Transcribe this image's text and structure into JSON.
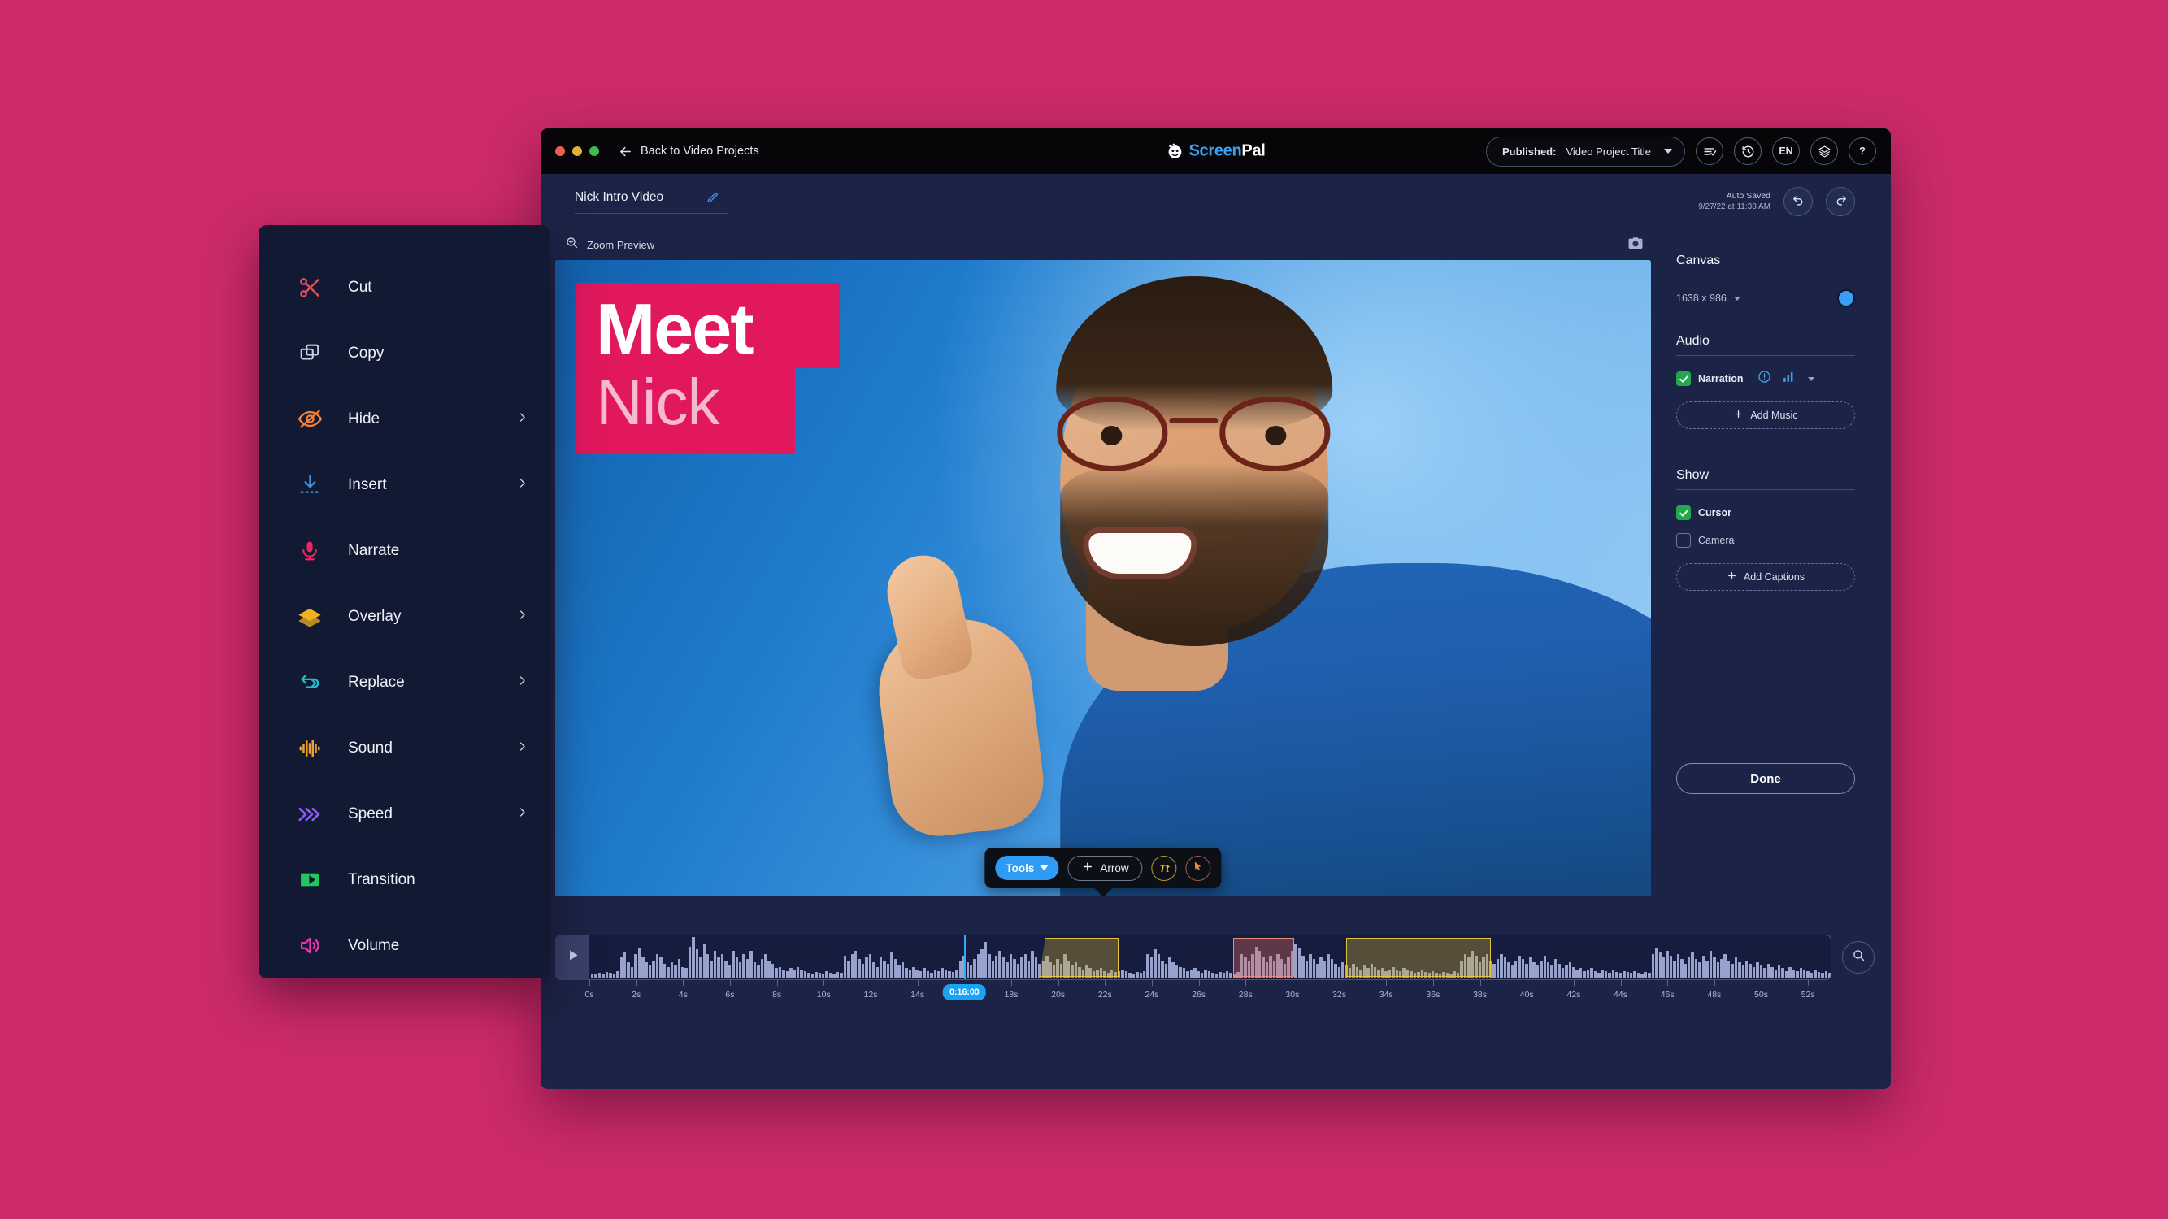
{
  "background_color": "#cc2a6b",
  "titlebar": {
    "back_label": "Back to Video Projects",
    "brand_first": "Screen",
    "brand_second": "Pal",
    "published_prefix": "Published:",
    "published_title": "Video Project Title",
    "icons": [
      {
        "name": "checklist-icon",
        "label": ""
      },
      {
        "name": "history-clock-icon",
        "label": ""
      },
      {
        "name": "language-icon",
        "label": "EN"
      },
      {
        "name": "layers-icon",
        "label": ""
      },
      {
        "name": "help-icon",
        "label": "?"
      }
    ]
  },
  "project": {
    "title": "Nick Intro Video",
    "edit_icon": "edit-pencil-icon",
    "autosave_line1": "Auto Saved",
    "autosave_line2": "9/27/22 at 11:38 AM",
    "undo_icon": "undo-icon",
    "redo_icon": "redo-icon"
  },
  "preview": {
    "zoom_label": "Zoom Preview",
    "zoom_icon": "magnifier-plus-icon",
    "camera_icon": "camera-icon",
    "overlay_line1": "Meet",
    "overlay_line2": "Nick",
    "overlay_bg_color": "#e1185e"
  },
  "toolbar": {
    "tools_label": "Tools",
    "arrow_label": "Arrow",
    "text_tool_label": "Tt",
    "cursor_tool_icon": "cursor-arrow-icon"
  },
  "side_panel": {
    "canvas_heading": "Canvas",
    "canvas_size": "1638 x 986",
    "audio_heading": "Audio",
    "narration_label": "Narration",
    "narration_alert_icon": "alert-circle-icon",
    "narration_levels_icon": "audio-levels-icon",
    "add_music_label": "Add Music",
    "show_heading": "Show",
    "cursor_label": "Cursor",
    "camera_label": "Camera",
    "add_captions_label": "Add Captions",
    "done_label": "Done",
    "accent_blue": "#3c9ef3",
    "accent_green": "#23a94c"
  },
  "timeline": {
    "play_icon": "play-icon",
    "search_icon": "search-icon",
    "playhead_time": "0:16:00",
    "playhead_position_seconds": 16,
    "tick_labels": [
      "0s",
      "2s",
      "4s",
      "6s",
      "8s",
      "10s",
      "12s",
      "14s",
      "18s",
      "20s",
      "22s",
      "24s",
      "26s",
      "28s",
      "30s",
      "32s",
      "34s",
      "36s",
      "38s",
      "40s",
      "42s",
      "44s",
      "46s",
      "48s",
      "50s",
      "52s"
    ],
    "tick_seconds": [
      0,
      2,
      4,
      6,
      8,
      10,
      12,
      14,
      18,
      20,
      22,
      24,
      26,
      28,
      30,
      32,
      34,
      36,
      38,
      40,
      42,
      44,
      46,
      48,
      50,
      52
    ],
    "range_seconds": [
      0,
      53
    ],
    "clips": [
      {
        "name": "yellow-fade-clip",
        "start_seconds": 19.2,
        "end_seconds": 22.6,
        "color": "#e2c23d",
        "shape": "trapezoid"
      },
      {
        "name": "red-clip",
        "start_seconds": 27.5,
        "end_seconds": 30.1,
        "color": "#e98a7a",
        "shape": "rect"
      },
      {
        "name": "yellow-clip",
        "start_seconds": 32.3,
        "end_seconds": 38.5,
        "color": "#e2c23d",
        "shape": "rect"
      }
    ],
    "waveform": [
      4,
      5,
      6,
      5,
      7,
      6,
      5,
      8,
      26,
      32,
      20,
      14,
      30,
      38,
      26,
      20,
      16,
      22,
      30,
      26,
      18,
      14,
      20,
      16,
      24,
      14,
      12,
      40,
      52,
      36,
      26,
      44,
      30,
      22,
      34,
      26,
      30,
      22,
      16,
      34,
      26,
      20,
      30,
      24,
      34,
      20,
      16,
      24,
      30,
      22,
      18,
      12,
      14,
      10,
      8,
      12,
      10,
      14,
      10,
      8,
      6,
      5,
      7,
      6,
      5,
      8,
      6,
      5,
      7,
      6,
      28,
      22,
      30,
      34,
      24,
      18,
      26,
      30,
      20,
      14,
      26,
      22,
      18,
      32,
      24,
      16,
      20,
      12,
      10,
      14,
      10,
      8,
      12,
      8,
      6,
      10,
      8,
      12,
      10,
      8,
      7,
      9,
      22,
      28,
      20,
      16,
      24,
      30,
      36,
      46,
      30,
      22,
      28,
      34,
      26,
      20,
      30,
      24,
      18,
      26,
      30,
      22,
      34,
      26,
      18,
      22,
      28,
      20,
      16,
      24,
      18,
      30,
      22,
      16,
      20,
      14,
      10,
      16,
      12,
      8,
      10,
      12,
      8,
      6,
      9,
      7,
      8,
      10,
      8,
      6,
      5,
      7,
      6,
      8,
      30,
      26,
      36,
      30,
      22,
      18,
      26,
      20,
      16,
      14,
      12,
      8,
      10,
      12,
      8,
      6,
      10,
      8,
      6,
      5,
      7,
      6,
      8,
      6,
      5,
      7,
      30,
      26,
      22,
      30,
      40,
      34,
      26,
      20,
      28,
      22,
      30,
      24,
      18,
      26,
      34,
      44,
      38,
      28,
      22,
      30,
      24,
      18,
      26,
      22,
      30,
      24,
      18,
      14,
      20,
      16,
      12,
      18,
      14,
      10,
      16,
      12,
      18,
      14,
      10,
      12,
      8,
      10,
      14,
      10,
      8,
      12,
      10,
      8,
      6,
      7,
      9,
      7,
      6,
      8,
      6,
      5,
      7,
      6,
      5,
      8,
      6,
      22,
      30,
      26,
      34,
      28,
      20,
      26,
      30,
      22,
      18,
      24,
      30,
      26,
      20,
      16,
      22,
      28,
      24,
      18,
      26,
      20,
      16,
      22,
      28,
      20,
      16,
      24,
      18,
      12,
      16,
      20,
      14,
      10,
      12,
      8,
      10,
      12,
      8,
      6,
      10,
      8,
      6,
      9,
      7,
      6,
      8,
      7,
      6,
      8,
      6,
      5,
      7,
      6,
      30,
      38,
      32,
      26,
      34,
      28,
      22,
      30,
      24,
      18,
      26,
      32,
      24,
      20,
      28,
      22,
      34,
      26,
      20,
      24,
      30,
      22,
      18,
      26,
      20,
      16,
      22,
      18,
      14,
      20,
      16,
      12,
      18,
      14,
      10,
      16,
      12,
      8,
      14,
      10,
      8,
      12,
      10,
      8,
      6,
      9,
      7,
      6,
      8,
      6
    ]
  },
  "context_menu": {
    "items": [
      {
        "label": "Cut",
        "icon": "scissors-icon",
        "color": "#e0515c",
        "submenu": false
      },
      {
        "label": "Copy",
        "icon": "copy-icon",
        "color": "#c9d0e4",
        "submenu": false
      },
      {
        "label": "Hide",
        "icon": "eye-off-icon",
        "color": "#f0803c",
        "submenu": true
      },
      {
        "label": "Insert",
        "icon": "insert-down-icon",
        "color": "#3f8fe0",
        "submenu": true
      },
      {
        "label": "Narrate",
        "icon": "microphone-icon",
        "color": "#e8265f",
        "submenu": false
      },
      {
        "label": "Overlay",
        "icon": "layers-icon",
        "color": "#f0b020",
        "submenu": true
      },
      {
        "label": "Replace",
        "icon": "swap-icon",
        "color": "#22b8cf",
        "submenu": true
      },
      {
        "label": "Sound",
        "icon": "sound-wave-icon",
        "color": "#f0a030",
        "submenu": true
      },
      {
        "label": "Speed",
        "icon": "fast-forward-icon",
        "color": "#8a5cf0",
        "submenu": true
      },
      {
        "label": "Transition",
        "icon": "transition-icon",
        "color": "#22c55e",
        "submenu": false
      },
      {
        "label": "Volume",
        "icon": "volume-icon",
        "color": "#e838b0",
        "submenu": false
      }
    ]
  }
}
